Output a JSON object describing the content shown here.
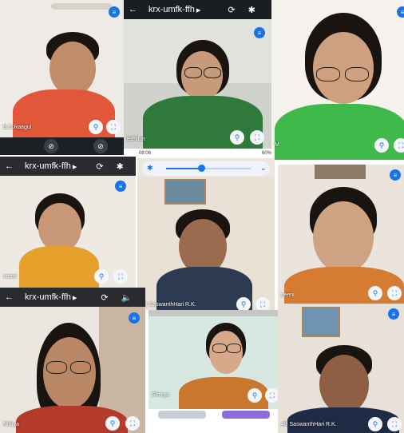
{
  "tiles": [
    {
      "name": "B.S.Raagul"
    },
    {
      "header": "krx-umfk-ffh",
      "name": "Ezhilan"
    },
    {
      "name": "M"
    },
    {
      "header": "krx-umfk-ffh",
      "name": "seeni"
    },
    {
      "status_time": "08:06",
      "battery": "60%",
      "name": "4B SaswanthHari R.K."
    },
    {
      "name": "seeni"
    },
    {
      "header": "krx-umfk-ffh",
      "name": "Nithya"
    },
    {
      "name": "Shreya"
    },
    {
      "name": "4B SaswanthHari R.K."
    }
  ],
  "colors": {
    "accent": "#1a73e8",
    "bar": "#1c1f23"
  }
}
